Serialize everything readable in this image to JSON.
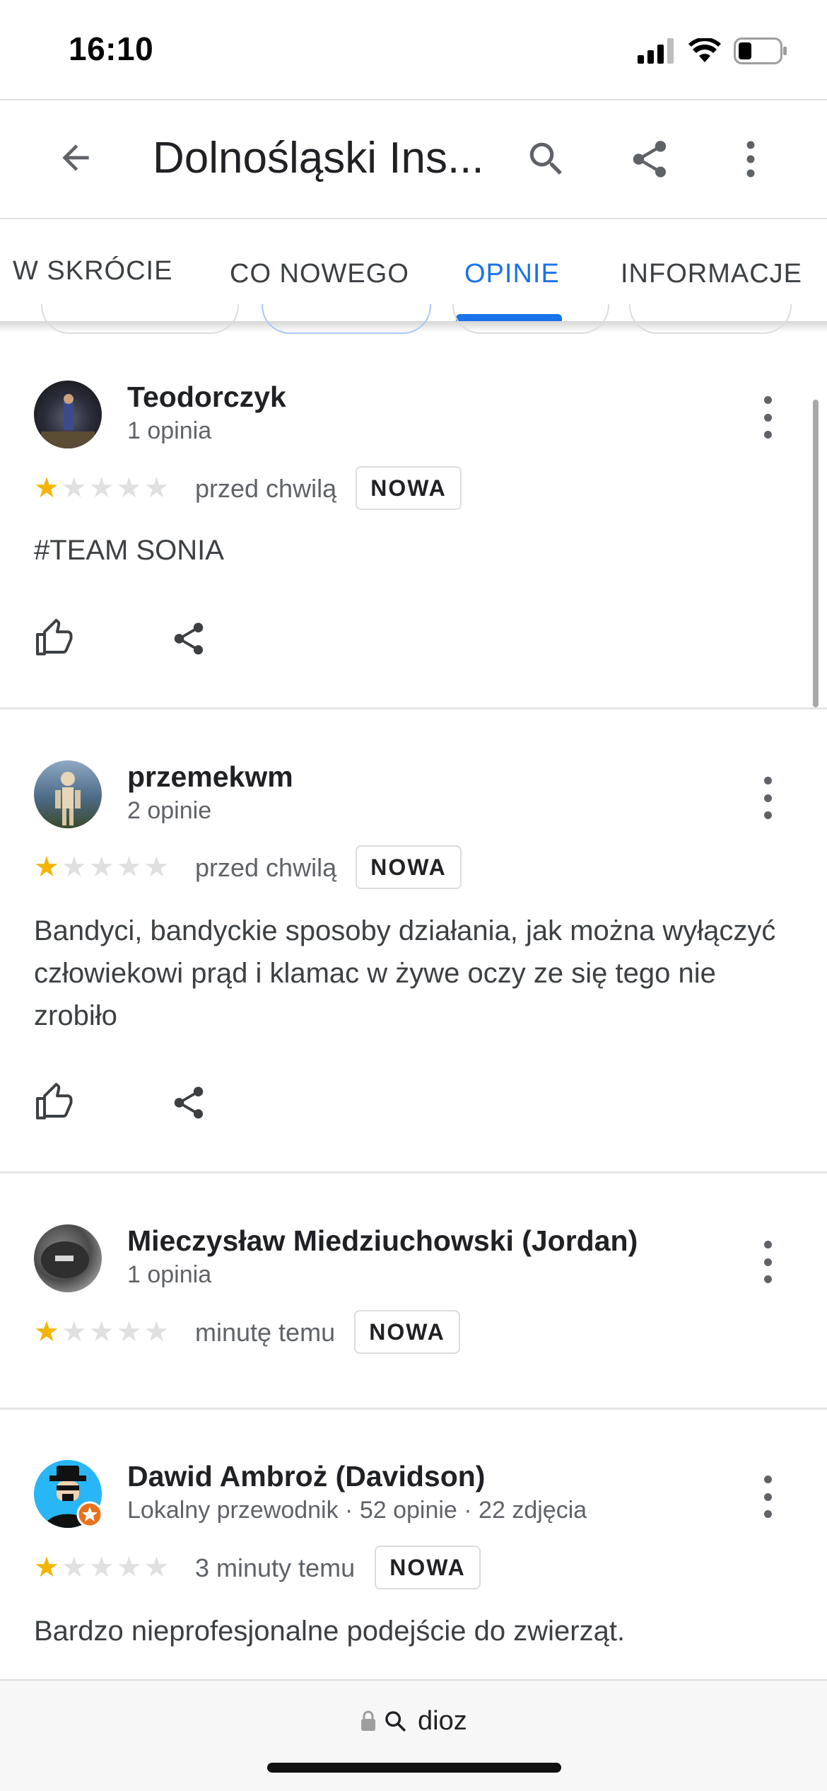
{
  "status_bar": {
    "time": "16:10"
  },
  "app_bar": {
    "title": "Dolnośląski Ins..."
  },
  "tabs": [
    {
      "label": "W SKRÓCIE",
      "active": false
    },
    {
      "label": "CO NOWEGO",
      "active": false
    },
    {
      "label": "OPINIE",
      "active": true
    },
    {
      "label": "INFORMACJE",
      "active": false
    }
  ],
  "reviews": [
    {
      "author": "Teodorczyk",
      "meta": "1 opinia",
      "rating": 1,
      "time": "przed chwilą",
      "badge": "NOWA",
      "text": "#TEAM SONIA"
    },
    {
      "author": "przemekwm",
      "meta": "2 opinie",
      "rating": 1,
      "time": "przed chwilą",
      "badge": "NOWA",
      "text": "Bandyci, bandyckie sposoby działania, jak można wyłączyć człowiekowi prąd i klamac w żywe oczy ze się tego nie zrobiło"
    },
    {
      "author": "Mieczysław Miedziuchowski (Jordan)",
      "meta": "1 opinia",
      "rating": 1,
      "time": "minutę temu",
      "badge": "NOWA",
      "text": ""
    },
    {
      "author": "Dawid Ambroż (Davidson)",
      "meta": "Lokalny przewodnik · 52 opinie · 22 zdjęcia",
      "rating": 1,
      "time": "3 minuty temu",
      "badge": "NOWA",
      "text": "Bardzo nieprofesjonalne podejście do zwierząt."
    }
  ],
  "url_bar": {
    "text": "dioz"
  },
  "colors": {
    "accent": "#1a73e8",
    "star": "#f4b400"
  }
}
